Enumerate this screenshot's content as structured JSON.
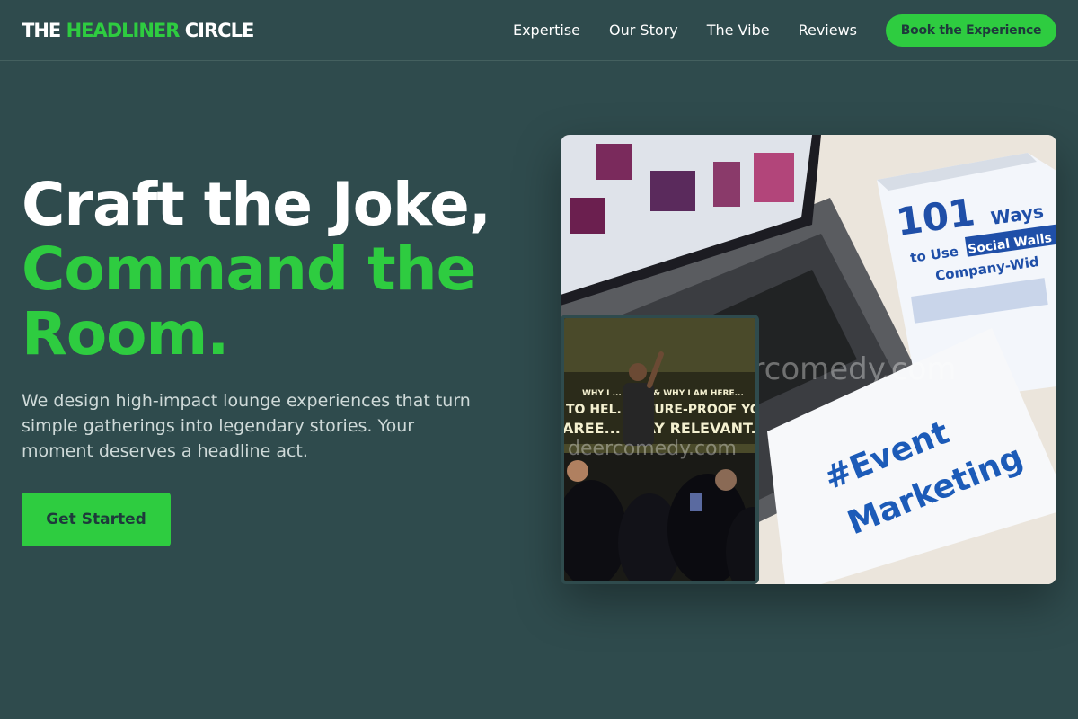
{
  "nav": {
    "logo": {
      "part1": "THE ",
      "part2": "HEADLINER",
      "part3": " CIRCLE"
    },
    "links": [
      "Expertise",
      "Our Story",
      "The Vibe",
      "Reviews"
    ],
    "cta_label": "Book the Experience"
  },
  "hero": {
    "title_line1": "Craft the Joke,",
    "title_line2": "Command the",
    "title_line3": "Room.",
    "description": "We design high-impact lounge experiences that turn simple gatherings into legendary stories. Your moment deserves a headline act.",
    "cta_label": "Get Started"
  },
  "images": {
    "main": {
      "book_number": "101",
      "book_title_1": "Ways",
      "book_title_2": "to Use",
      "book_title_3": "Social Walls",
      "book_title_4": "Company-Wid",
      "sign_line1": "#Event",
      "sign_line2": "Marketing",
      "watermark": "deercomedy.com"
    },
    "inset": {
      "screen_line1": "WHY I ... BOOK & WHY I AM HERE...",
      "screen_line2": "TO HEL... UTURE-PROOF YOUR",
      "screen_line3": "AREE... STAY RELEVANT.",
      "watermark": "deercomedy.com"
    }
  },
  "colors": {
    "background": "#2f4b4d",
    "accent": "#2ecc40",
    "text": "#ffffff",
    "muted_text": "#cfdad9"
  }
}
